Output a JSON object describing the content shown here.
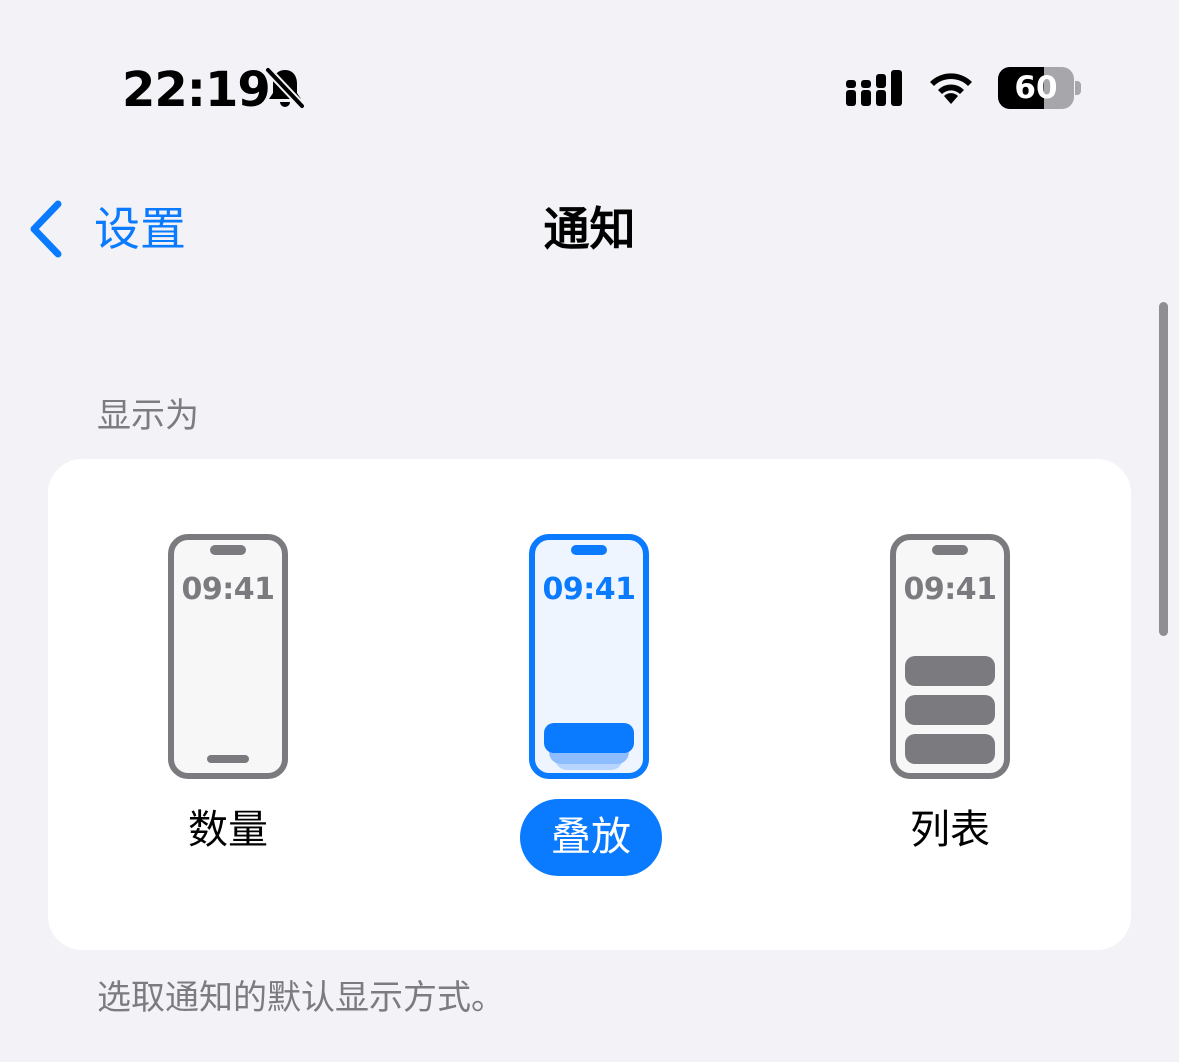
{
  "status_bar": {
    "time": "22:19",
    "battery_text": "60",
    "battery_level": 0.6,
    "icons": [
      "bell-slash-icon",
      "cellular-signal-icon",
      "wifi-icon",
      "battery-icon"
    ]
  },
  "nav": {
    "back_label": "设置",
    "back_icon": "chevron-left-icon",
    "title": "通知"
  },
  "display_as": {
    "header": "显示为",
    "footer": "选取通知的默认显示方式。",
    "options": [
      {
        "label": "数量",
        "clock": "09:41",
        "selected": false
      },
      {
        "label": "叠放",
        "clock": "09:41",
        "selected": true
      },
      {
        "label": "列表",
        "clock": "09:41",
        "selected": false
      }
    ]
  },
  "colors": {
    "accent": "#0A7AFF",
    "background": "#F2F2F7",
    "card": "#FFFFFF",
    "secondary_text": "#7C7C80",
    "phone_grey": "#7B7B7F"
  }
}
